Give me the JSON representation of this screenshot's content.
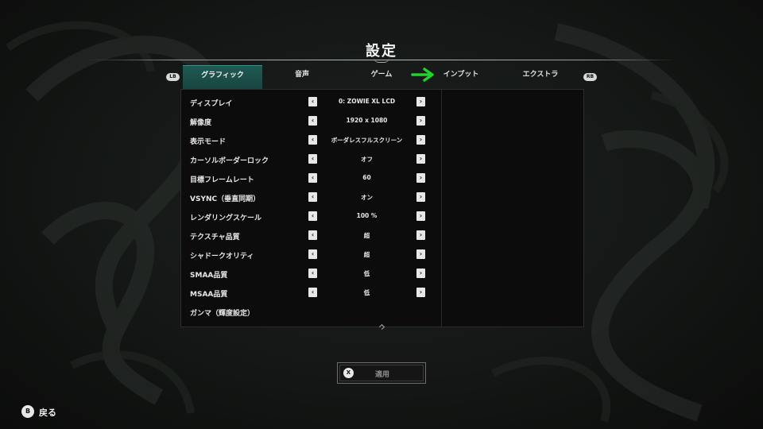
{
  "title": "設定",
  "bumpers": {
    "left": "LB",
    "right": "RB"
  },
  "tabs": [
    {
      "label": "グラフィック",
      "active": true
    },
    {
      "label": "音声",
      "active": false
    },
    {
      "label": "ゲーム",
      "active": false
    },
    {
      "label": "インプット",
      "active": false
    },
    {
      "label": "エクストラ",
      "active": false
    }
  ],
  "icons": {
    "left_arrow": "‹",
    "right_arrow": "›",
    "highlight_arrow": "green-right-arrow-icon"
  },
  "settings": [
    {
      "label": "ディスプレイ",
      "value": "0: ZOWIE XL LCD"
    },
    {
      "label": "解像度",
      "value": "1920 x 1080"
    },
    {
      "label": "表示モード",
      "value": "ボーダレスフルスクリーン"
    },
    {
      "label": "カーソルボーダーロック",
      "value": "オフ"
    },
    {
      "label": "目標フレームレート",
      "value": "60"
    },
    {
      "label": "VSYNC（垂直同期）",
      "value": "オン"
    },
    {
      "label": "レンダリングスケール",
      "value": "100 %"
    },
    {
      "label": "テクスチャ品質",
      "value": "超"
    },
    {
      "label": "シャドークオリティ",
      "value": "超"
    },
    {
      "label": "SMAA品質",
      "value": "低"
    },
    {
      "label": "MSAA品質",
      "value": "低"
    },
    {
      "label": "ガンマ（輝度設定）",
      "value": null
    }
  ],
  "apply": {
    "key": "X",
    "label": "適用"
  },
  "back": {
    "key": "B",
    "label": "戻る"
  },
  "colors": {
    "accent_tab": "#1f5a52",
    "highlight_arrow": "#22d12c"
  }
}
